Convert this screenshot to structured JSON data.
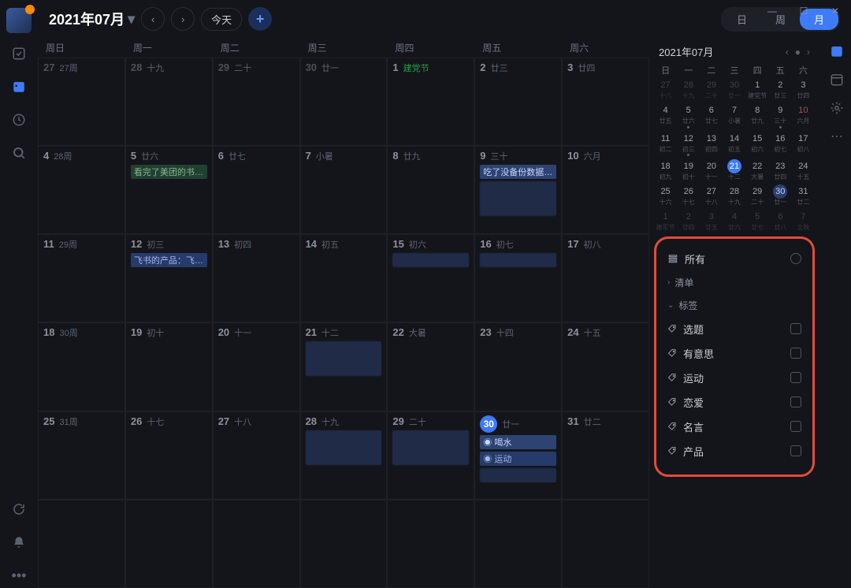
{
  "window": {
    "min": "—",
    "max": "☐",
    "close": "✕"
  },
  "header": {
    "title": "2021年07月",
    "today": "今天",
    "views": {
      "day": "日",
      "week": "周",
      "month": "月"
    }
  },
  "dow": [
    "周日",
    "周一",
    "周二",
    "周三",
    "周四",
    "周五",
    "周六"
  ],
  "rows": [
    [
      {
        "d": "27",
        "l": "27周",
        "other": true
      },
      {
        "d": "28",
        "l": "十九",
        "other": true
      },
      {
        "d": "29",
        "l": "二十",
        "other": true
      },
      {
        "d": "30",
        "l": "廿一",
        "other": true
      },
      {
        "d": "1",
        "l": "建党节",
        "festival": true
      },
      {
        "d": "2",
        "l": "廿三"
      },
      {
        "d": "3",
        "l": "廿四"
      }
    ],
    [
      {
        "d": "4",
        "l": "28周"
      },
      {
        "d": "5",
        "l": "廿六",
        "evt": {
          "t": "看完了美团的书…",
          "k": 2
        }
      },
      {
        "d": "6",
        "l": "廿七"
      },
      {
        "d": "7",
        "l": "小暑"
      },
      {
        "d": "8",
        "l": "廿九"
      },
      {
        "d": "9",
        "l": "三十",
        "evt": {
          "t": "吃了没备份数据…",
          "k": 1
        },
        "blur": "big"
      },
      {
        "d": "10",
        "l": "六月"
      }
    ],
    [
      {
        "d": "11",
        "l": "29周"
      },
      {
        "d": "12",
        "l": "初三",
        "evt": {
          "t": "飞书的产品：飞…",
          "k": 3
        }
      },
      {
        "d": "13",
        "l": "初四"
      },
      {
        "d": "14",
        "l": "初五"
      },
      {
        "d": "15",
        "l": "初六",
        "blur": "small"
      },
      {
        "d": "16",
        "l": "初七",
        "blur": "small"
      },
      {
        "d": "17",
        "l": "初八"
      }
    ],
    [
      {
        "d": "18",
        "l": "30周"
      },
      {
        "d": "19",
        "l": "初十"
      },
      {
        "d": "20",
        "l": "十一"
      },
      {
        "d": "21",
        "l": "十二",
        "blur": "big"
      },
      {
        "d": "22",
        "l": "大暑"
      },
      {
        "d": "23",
        "l": "十四"
      },
      {
        "d": "24",
        "l": "十五"
      }
    ],
    [
      {
        "d": "25",
        "l": "31周"
      },
      {
        "d": "26",
        "l": "十七"
      },
      {
        "d": "27",
        "l": "十八"
      },
      {
        "d": "28",
        "l": "十九",
        "blur": "big"
      },
      {
        "d": "29",
        "l": "二十",
        "blur": "big"
      },
      {
        "d": "30",
        "l": "廿一",
        "today": true,
        "evts": [
          {
            "t": "◉ 喝水",
            "k": 1
          },
          {
            "t": "◉ 运动",
            "k": 3
          }
        ],
        "blur": "small"
      },
      {
        "d": "31",
        "l": "廿二"
      }
    ],
    [
      {
        "d": "",
        "l": ""
      },
      {
        "d": "",
        "l": ""
      },
      {
        "d": "",
        "l": ""
      },
      {
        "d": "",
        "l": ""
      },
      {
        "d": "",
        "l": ""
      },
      {
        "d": "",
        "l": ""
      },
      {
        "d": "",
        "l": ""
      }
    ]
  ],
  "mini": {
    "title": "2021年07月",
    "dow": [
      "日",
      "一",
      "二",
      "三",
      "四",
      "五",
      "六"
    ],
    "cells": [
      {
        "d": "27",
        "l": "十八",
        "o": true
      },
      {
        "d": "28",
        "l": "十九",
        "o": true
      },
      {
        "d": "29",
        "l": "二十",
        "o": true
      },
      {
        "d": "30",
        "l": "廿一",
        "o": true
      },
      {
        "d": "1",
        "l": "建党节"
      },
      {
        "d": "2",
        "l": "廿三"
      },
      {
        "d": "3",
        "l": "廿四"
      },
      {
        "d": "4",
        "l": "廿五"
      },
      {
        "d": "5",
        "l": "廿六",
        "dot": true
      },
      {
        "d": "6",
        "l": "廿七"
      },
      {
        "d": "7",
        "l": "小暑"
      },
      {
        "d": "8",
        "l": "廿九"
      },
      {
        "d": "9",
        "l": "三十",
        "dot": true
      },
      {
        "d": "10",
        "l": "六月",
        "hol": true
      },
      {
        "d": "11",
        "l": "初二"
      },
      {
        "d": "12",
        "l": "初三",
        "dot": true
      },
      {
        "d": "13",
        "l": "初四"
      },
      {
        "d": "14",
        "l": "初五"
      },
      {
        "d": "15",
        "l": "初六"
      },
      {
        "d": "16",
        "l": "初七"
      },
      {
        "d": "17",
        "l": "初八"
      },
      {
        "d": "18",
        "l": "初九"
      },
      {
        "d": "19",
        "l": "初十"
      },
      {
        "d": "20",
        "l": "十一"
      },
      {
        "d": "21",
        "l": "十二",
        "sel": true
      },
      {
        "d": "22",
        "l": "大暑"
      },
      {
        "d": "23",
        "l": "廿四"
      },
      {
        "d": "24",
        "l": "十五"
      },
      {
        "d": "25",
        "l": "十六"
      },
      {
        "d": "26",
        "l": "十七"
      },
      {
        "d": "27",
        "l": "十八"
      },
      {
        "d": "28",
        "l": "十九"
      },
      {
        "d": "29",
        "l": "二十"
      },
      {
        "d": "30",
        "l": "廿一",
        "today": true
      },
      {
        "d": "31",
        "l": "廿二"
      },
      {
        "d": "1",
        "l": "建军节",
        "o": true
      },
      {
        "d": "2",
        "l": "廿四",
        "o": true
      },
      {
        "d": "3",
        "l": "廿五",
        "o": true
      },
      {
        "d": "4",
        "l": "廿六",
        "o": true
      },
      {
        "d": "5",
        "l": "廿七",
        "o": true
      },
      {
        "d": "6",
        "l": "廿八",
        "o": true
      },
      {
        "d": "7",
        "l": "立秋",
        "o": true
      }
    ]
  },
  "filters": {
    "all": "所有",
    "list": "清单",
    "tags_title": "标签",
    "tags": [
      "选题",
      "有意思",
      "运动",
      "恋爱",
      "名言",
      "产品"
    ]
  }
}
